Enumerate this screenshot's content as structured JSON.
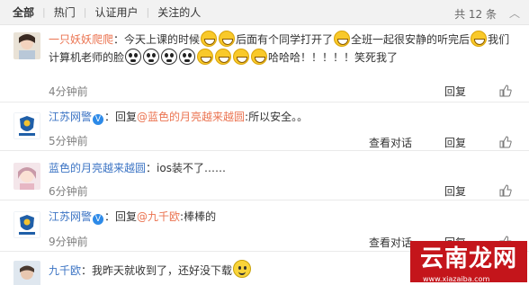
{
  "filter": {
    "tabs": [
      "全部",
      "热门",
      "认证用户",
      "关注的人"
    ],
    "total": "共 12 条"
  },
  "comments": [
    {
      "user": "一只妖妖爬爬",
      "seg1": "：今天上课的时候",
      "seg2": "后面有个同学打开了",
      "seg3": "全班一起很安静的听完后",
      "seg4": "我们计算机老师的脸",
      "seg5": "哈哈哈！！！！！笑死我了",
      "time": "4分钟前",
      "reply": "回复"
    },
    {
      "user": "江苏网警",
      "prefix": "：回复",
      "mention": "@蓝色的月亮越来越圆",
      "body": ":所以安全。。",
      "time": "5分钟前",
      "view": "查看对话",
      "reply": "回复"
    },
    {
      "user": "蓝色的月亮越来越圆",
      "body": "：ios装不了……",
      "time": "6分钟前",
      "reply": "回复"
    },
    {
      "user": "江苏网警",
      "prefix": "：回复",
      "mention": "@九千欧",
      "body": ":棒棒的",
      "time": "9分钟前",
      "view": "查看对话",
      "reply": "回复"
    },
    {
      "user": "九千欧",
      "body": "：我昨天就收到了，还好没下载"
    }
  ],
  "watermark": {
    "text": "云南龙网",
    "sub": "www.xiazaiba.com"
  },
  "icons": {
    "like": "thumb-up-icon",
    "verified": "verified-badge-icon",
    "collapse": "chevron-up-icon"
  }
}
